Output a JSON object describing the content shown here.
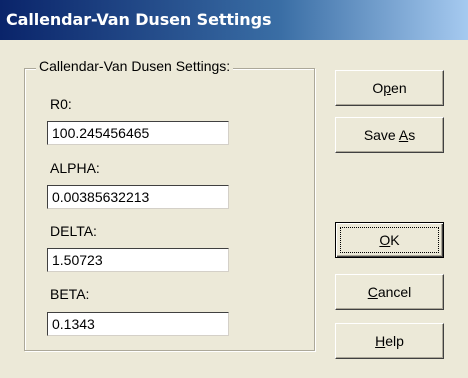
{
  "window": {
    "title": "Callendar-Van Dusen Settings"
  },
  "group": {
    "legend": "Callendar-Van Dusen Settings:"
  },
  "fields": [
    {
      "label": "R0:",
      "value": "100.245456465"
    },
    {
      "label": "ALPHA:",
      "value": "0.00385632213"
    },
    {
      "label": "DELTA:",
      "value": "1.50723"
    },
    {
      "label": "BETA:",
      "value": "0.1343"
    }
  ],
  "buttons": {
    "open": {
      "before": "O",
      "mnemonic": "p",
      "after": "en"
    },
    "save_as": {
      "before": "Save ",
      "mnemonic": "A",
      "after": "s"
    },
    "ok": {
      "before": "",
      "mnemonic": "O",
      "after": "K"
    },
    "cancel": {
      "before": "",
      "mnemonic": "C",
      "after": "ancel"
    },
    "help": {
      "before": "",
      "mnemonic": "H",
      "after": "elp"
    }
  },
  "colors": {
    "titlebar_start": "#0a246a",
    "titlebar_end": "#a6caf0",
    "dialog_face": "#ece9d8"
  }
}
